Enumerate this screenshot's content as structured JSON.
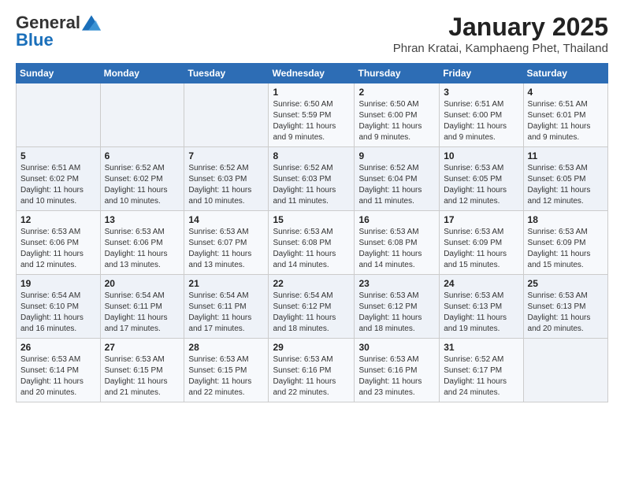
{
  "header": {
    "logo_general": "General",
    "logo_blue": "Blue",
    "month_title": "January 2025",
    "location": "Phran Kratai, Kamphaeng Phet, Thailand"
  },
  "weekdays": [
    "Sunday",
    "Monday",
    "Tuesday",
    "Wednesday",
    "Thursday",
    "Friday",
    "Saturday"
  ],
  "weeks": [
    [
      {
        "day": "",
        "info": ""
      },
      {
        "day": "",
        "info": ""
      },
      {
        "day": "",
        "info": ""
      },
      {
        "day": "1",
        "info": "Sunrise: 6:50 AM\nSunset: 5:59 PM\nDaylight: 11 hours and 9 minutes."
      },
      {
        "day": "2",
        "info": "Sunrise: 6:50 AM\nSunset: 6:00 PM\nDaylight: 11 hours and 9 minutes."
      },
      {
        "day": "3",
        "info": "Sunrise: 6:51 AM\nSunset: 6:00 PM\nDaylight: 11 hours and 9 minutes."
      },
      {
        "day": "4",
        "info": "Sunrise: 6:51 AM\nSunset: 6:01 PM\nDaylight: 11 hours and 9 minutes."
      }
    ],
    [
      {
        "day": "5",
        "info": "Sunrise: 6:51 AM\nSunset: 6:02 PM\nDaylight: 11 hours and 10 minutes."
      },
      {
        "day": "6",
        "info": "Sunrise: 6:52 AM\nSunset: 6:02 PM\nDaylight: 11 hours and 10 minutes."
      },
      {
        "day": "7",
        "info": "Sunrise: 6:52 AM\nSunset: 6:03 PM\nDaylight: 11 hours and 10 minutes."
      },
      {
        "day": "8",
        "info": "Sunrise: 6:52 AM\nSunset: 6:03 PM\nDaylight: 11 hours and 11 minutes."
      },
      {
        "day": "9",
        "info": "Sunrise: 6:52 AM\nSunset: 6:04 PM\nDaylight: 11 hours and 11 minutes."
      },
      {
        "day": "10",
        "info": "Sunrise: 6:53 AM\nSunset: 6:05 PM\nDaylight: 11 hours and 12 minutes."
      },
      {
        "day": "11",
        "info": "Sunrise: 6:53 AM\nSunset: 6:05 PM\nDaylight: 11 hours and 12 minutes."
      }
    ],
    [
      {
        "day": "12",
        "info": "Sunrise: 6:53 AM\nSunset: 6:06 PM\nDaylight: 11 hours and 12 minutes."
      },
      {
        "day": "13",
        "info": "Sunrise: 6:53 AM\nSunset: 6:06 PM\nDaylight: 11 hours and 13 minutes."
      },
      {
        "day": "14",
        "info": "Sunrise: 6:53 AM\nSunset: 6:07 PM\nDaylight: 11 hours and 13 minutes."
      },
      {
        "day": "15",
        "info": "Sunrise: 6:53 AM\nSunset: 6:08 PM\nDaylight: 11 hours and 14 minutes."
      },
      {
        "day": "16",
        "info": "Sunrise: 6:53 AM\nSunset: 6:08 PM\nDaylight: 11 hours and 14 minutes."
      },
      {
        "day": "17",
        "info": "Sunrise: 6:53 AM\nSunset: 6:09 PM\nDaylight: 11 hours and 15 minutes."
      },
      {
        "day": "18",
        "info": "Sunrise: 6:53 AM\nSunset: 6:09 PM\nDaylight: 11 hours and 15 minutes."
      }
    ],
    [
      {
        "day": "19",
        "info": "Sunrise: 6:54 AM\nSunset: 6:10 PM\nDaylight: 11 hours and 16 minutes."
      },
      {
        "day": "20",
        "info": "Sunrise: 6:54 AM\nSunset: 6:11 PM\nDaylight: 11 hours and 17 minutes."
      },
      {
        "day": "21",
        "info": "Sunrise: 6:54 AM\nSunset: 6:11 PM\nDaylight: 11 hours and 17 minutes."
      },
      {
        "day": "22",
        "info": "Sunrise: 6:54 AM\nSunset: 6:12 PM\nDaylight: 11 hours and 18 minutes."
      },
      {
        "day": "23",
        "info": "Sunrise: 6:53 AM\nSunset: 6:12 PM\nDaylight: 11 hours and 18 minutes."
      },
      {
        "day": "24",
        "info": "Sunrise: 6:53 AM\nSunset: 6:13 PM\nDaylight: 11 hours and 19 minutes."
      },
      {
        "day": "25",
        "info": "Sunrise: 6:53 AM\nSunset: 6:13 PM\nDaylight: 11 hours and 20 minutes."
      }
    ],
    [
      {
        "day": "26",
        "info": "Sunrise: 6:53 AM\nSunset: 6:14 PM\nDaylight: 11 hours and 20 minutes."
      },
      {
        "day": "27",
        "info": "Sunrise: 6:53 AM\nSunset: 6:15 PM\nDaylight: 11 hours and 21 minutes."
      },
      {
        "day": "28",
        "info": "Sunrise: 6:53 AM\nSunset: 6:15 PM\nDaylight: 11 hours and 22 minutes."
      },
      {
        "day": "29",
        "info": "Sunrise: 6:53 AM\nSunset: 6:16 PM\nDaylight: 11 hours and 22 minutes."
      },
      {
        "day": "30",
        "info": "Sunrise: 6:53 AM\nSunset: 6:16 PM\nDaylight: 11 hours and 23 minutes."
      },
      {
        "day": "31",
        "info": "Sunrise: 6:52 AM\nSunset: 6:17 PM\nDaylight: 11 hours and 24 minutes."
      },
      {
        "day": "",
        "info": ""
      }
    ]
  ]
}
